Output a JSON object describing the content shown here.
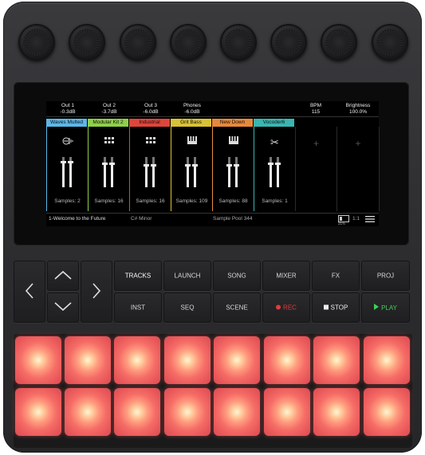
{
  "screen": {
    "header": [
      {
        "name": "Out 1",
        "value": "-0.3dB"
      },
      {
        "name": "Out 2",
        "value": "-3.7dB"
      },
      {
        "name": "Out 3",
        "value": "-6.0dB"
      },
      {
        "name": "Phones",
        "value": "-6.0dB"
      },
      {
        "name": "BPM",
        "value": "115"
      },
      {
        "name": "Brightness",
        "value": "100.0%"
      }
    ],
    "tracks": [
      {
        "name": "Waves Multed",
        "color": "#5bb8e8",
        "icon": "waveform-icon",
        "samples": "Samples: 2"
      },
      {
        "name": "Modular Kit 2",
        "color": "#8fcf4a",
        "icon": "grid-icon",
        "samples": "Samples: 16"
      },
      {
        "name": "Industrial",
        "color": "#e0453a",
        "icon": "grid-icon",
        "samples": "Samples: 16"
      },
      {
        "name": "Grit Bass",
        "color": "#d9c236",
        "icon": "keys-icon",
        "samples": "Samples: 109"
      },
      {
        "name": "New Down",
        "color": "#e8893a",
        "icon": "keys-icon",
        "samples": "Samples: 88"
      },
      {
        "name": "Vocoder6",
        "color": "#39b6b0",
        "icon": "scissors-icon",
        "samples": "Samples: 1"
      }
    ],
    "footer": {
      "song": "1-Welcome to the Future",
      "key": "C# Minor",
      "pool": "Sample Pool 344",
      "battery": "21%",
      "ratio": "1:1"
    }
  },
  "buttons": {
    "row1": [
      "TRACKS",
      "LAUNCH",
      "SONG",
      "MIXER",
      "FX",
      "PROJ"
    ],
    "row2": [
      "INST",
      "SEQ",
      "SCENE",
      "REC",
      "STOP",
      "PLAY"
    ]
  },
  "colors": {
    "rec": "#e23b3b",
    "play": "#3fcf56",
    "pad": "#f0615f"
  }
}
